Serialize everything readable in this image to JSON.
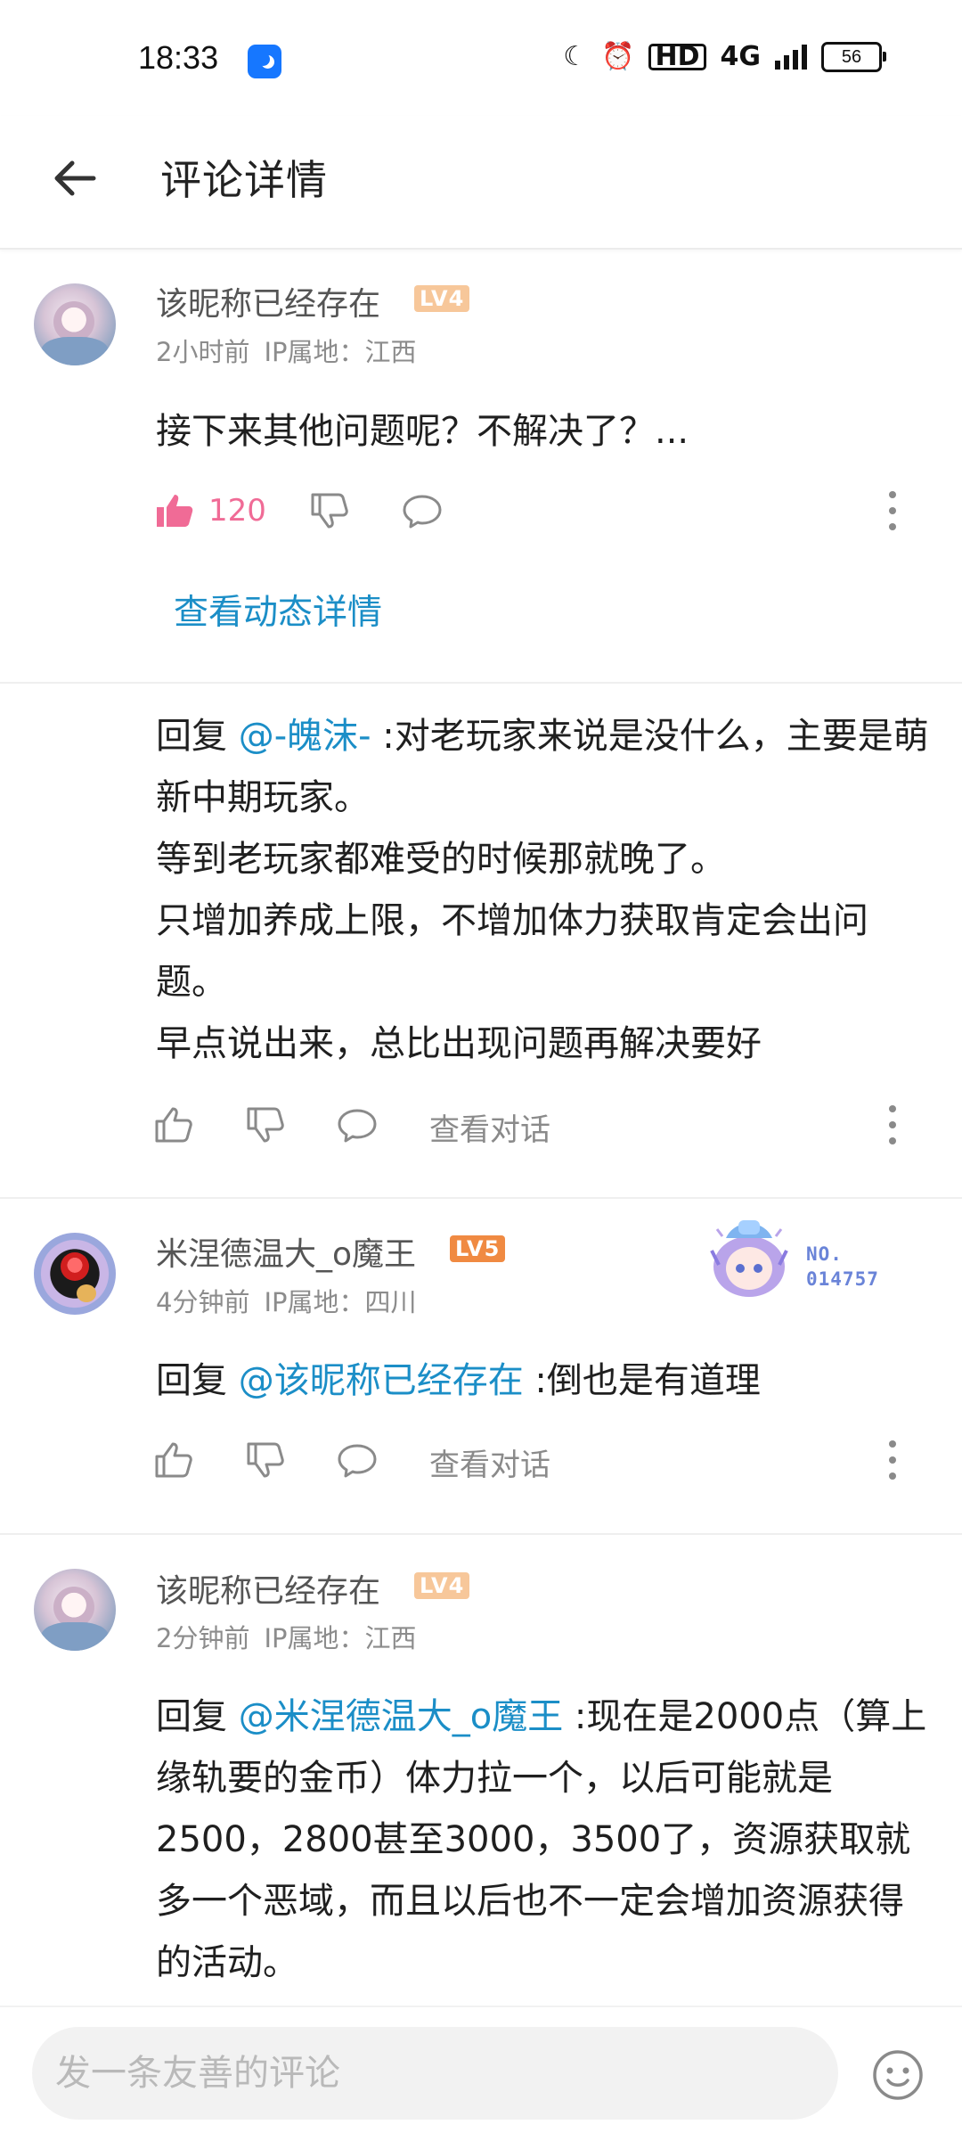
{
  "status_bar": {
    "time": "18:33",
    "network": "4G",
    "hd": "HD",
    "battery": "56"
  },
  "header": {
    "title": "评论详情"
  },
  "comments": [
    {
      "nickname": "该昵称已经存在",
      "level": "LV4",
      "time": "2小时前",
      "ip": "IP属地：江西",
      "text": "接下来其他问题呢？不解决了？...",
      "likes": "120",
      "detail_link": "查看动态详情"
    },
    {
      "reply_prefix": "回复 ",
      "mention": "@-魄沫-",
      "lines": [
        " :对老玩家来说是没什么，主要是萌新中期玩家。",
        "等到老玩家都难受的时候那就晚了。",
        "只增加养成上限，不增加体力获取肯定会出问题。",
        "早点说出来，总比出现问题再解决要好"
      ],
      "view_conversation": "查看对话"
    },
    {
      "nickname": "米涅德温大_o魔王",
      "level": "LV5",
      "time": "4分钟前",
      "ip": "IP属地：四川",
      "reply_prefix": "回复 ",
      "mention": "@该昵称已经存在",
      "text": " :倒也是有道理",
      "view_conversation": "查看对话",
      "badge": {
        "line1": "NO.",
        "line2": "014757"
      }
    },
    {
      "nickname": "该昵称已经存在",
      "level": "LV4",
      "time": "2分钟前",
      "ip": "IP属地：江西",
      "reply_prefix": "回复 ",
      "mention": "@米涅德温大_o魔王",
      "text": " :现在是2000点（算上缘轨要的金币）体力拉一个，以后可能就是2500，2800甚至3000，3500了，资源获取就多一个恶域，而且以后也不一定会增加资源获得的活动。"
    }
  ],
  "input": {
    "placeholder": "发一条友善的评论"
  },
  "colors": {
    "link": "#1b8ec7",
    "like": "#f06b96",
    "lv4": "#f7c79a",
    "lv5": "#f08a42"
  }
}
